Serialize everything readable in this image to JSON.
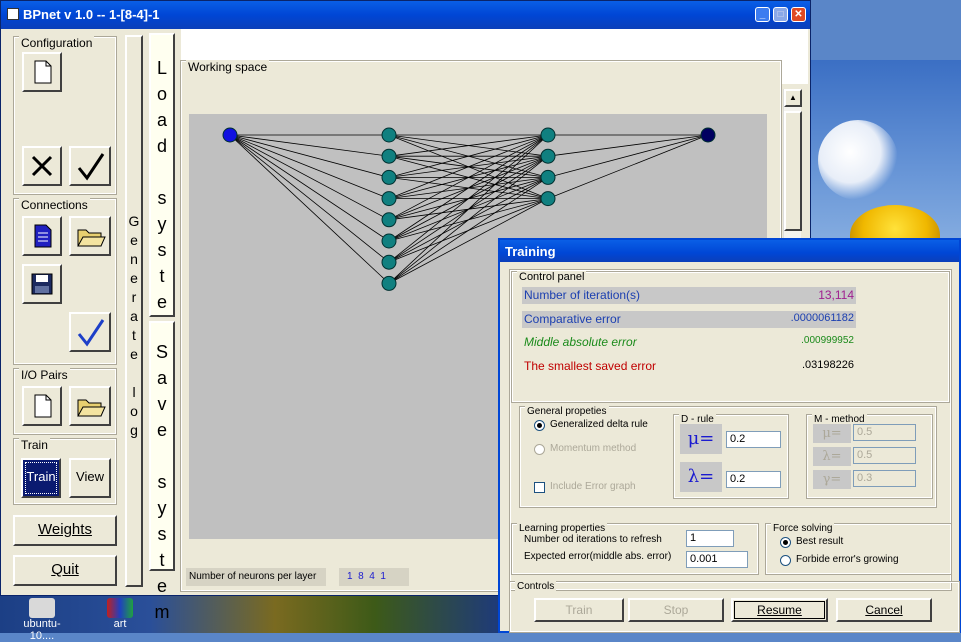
{
  "window": {
    "title": "BPnet v 1.0   --   1-[8-4]-1",
    "min": "_",
    "max": "□",
    "close": "✕"
  },
  "sidebar": {
    "configuration": "Configuration",
    "connections": "Connections",
    "io_pairs": "I/O Pairs",
    "train_group": "Train",
    "train_btn": "Train",
    "view_btn": "View",
    "weights_btn": "Weights",
    "quit_btn": "Quit"
  },
  "side_labels": {
    "generate_log": [
      "G",
      "e",
      "n",
      "e",
      "r",
      "a",
      "t",
      "e",
      "",
      "l",
      "o",
      "g"
    ],
    "load_system": [
      "L",
      "o",
      "a",
      "d",
      "",
      "s",
      "y",
      "s",
      "t",
      "e",
      "m"
    ],
    "save_system": [
      "S",
      "a",
      "v",
      "e",
      "",
      "s",
      "y",
      "s",
      "t",
      "e",
      "m"
    ]
  },
  "working_space": {
    "title": "Working space",
    "neurons_label": "Number of neurons per layer",
    "neurons_value": "1  8  4  1",
    "layers": [
      1,
      8,
      4,
      1
    ]
  },
  "training": {
    "title": "Training",
    "control_panel": "Control panel",
    "iterations_label": "Number of iteration(s)",
    "iterations_value": "13,114",
    "comparative_label": "Comparative error",
    "comparative_value": ".0000061182",
    "middle_label": "Middle absolute error",
    "middle_value": ".000999952",
    "smallest_label": "The smallest saved error",
    "smallest_value": ".03198226",
    "general_props": "General propeties",
    "gen_delta": "Generalized delta rule",
    "momentum": "Momentum method",
    "include_graph": "Include Error graph",
    "d_rule": "D - rule",
    "mu_sym": "μ=",
    "lambda_sym": "λ=",
    "mu_value": "0.2",
    "lambda_value": "0.2",
    "m_method": "M - method",
    "m_mu": "μ=",
    "m_lambda": "λ=",
    "m_gamma": "γ=",
    "m_mu_val": "0.5",
    "m_lambda_val": "0.5",
    "m_gamma_val": "0.3",
    "learning_props": "Learning properties",
    "refresh_label": "Number od iterations to refresh",
    "refresh_value": "1",
    "expected_label": "Expected error(middle abs. error)",
    "expected_value": "0.001",
    "force_solving": "Force solving",
    "best_result": "Best result",
    "forbide": "Forbide error's growing",
    "controls": "Controls",
    "train_btn": "Train",
    "stop_btn": "Stop",
    "resume_btn": "Resume",
    "cancel_btn": "Cancel"
  },
  "desktop": {
    "icon1": "ubuntu-10....",
    "icon2": "art"
  },
  "colors": {
    "iterations": "#a0208f",
    "comparative": "#1b3fb0",
    "middle": "#1a8a1a",
    "smallest": "#c00000",
    "neuron_input": "#1010e0",
    "neuron_hidden": "#108080",
    "neuron_output": "#000060"
  }
}
